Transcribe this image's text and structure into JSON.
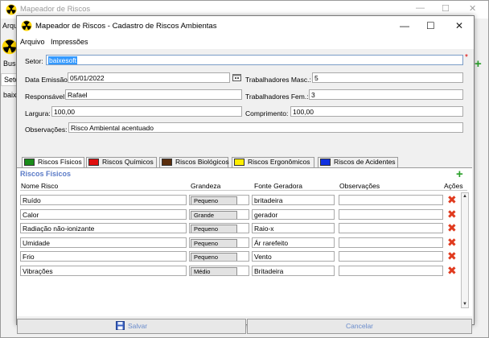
{
  "background_window": {
    "title": "Mapeador de Riscos",
    "menu_partial": "Arqu",
    "search_partial": "Busc",
    "column_partial": "Seto",
    "row_partial": "baix",
    "add_label": "+"
  },
  "dialog": {
    "title": "Mapeador de Riscos - Cadastro de Riscos Ambientas",
    "controls": {
      "minimize": "—",
      "maximize": "☐",
      "close": "✕"
    },
    "menu": [
      "Arquivo",
      "Impressões"
    ]
  },
  "form": {
    "setor_label": "Setor:",
    "setor_value": "baixesoft",
    "required_mark": "*",
    "emissao_label": "Data Emissão:",
    "emissao_value": "05/01/2022",
    "trab_masc_label": "Trabalhadores Masc.:",
    "trab_masc_value": "5",
    "responsavel_label": "Responsável:",
    "responsavel_value": "Rafael",
    "trab_fem_label": "Trabalhadores Fem.:",
    "trab_fem_value": "3",
    "largura_label": "Largura:",
    "largura_value": "100,00",
    "comprimento_label": "Comprimento:",
    "comprimento_value": "100,00",
    "observacoes_label": "Observações:",
    "observacoes_value": "Risco Ambiental acentuado"
  },
  "tabs": [
    {
      "label": "Riscos Físicos",
      "color": "#1a8c1a"
    },
    {
      "label": "Riscos Químicos",
      "color": "#e01010"
    },
    {
      "label": "Riscos Biológicos",
      "color": "#5a2d0c"
    },
    {
      "label": "Riscos Ergonômicos",
      "color": "#ffee00"
    },
    {
      "label": "Riscos de Acidentes",
      "color": "#1030e0"
    }
  ],
  "panel": {
    "section_title": "Riscos Físicos",
    "columns": [
      "Nome Risco",
      "Grandeza",
      "Fonte Geradora",
      "Observações",
      "Ações"
    ],
    "rows": [
      {
        "nome": "Ruído",
        "grandeza": "Pequeno",
        "fonte": "britadeira",
        "obs": ""
      },
      {
        "nome": "Calor",
        "grandeza": "Grande",
        "fonte": "gerador",
        "obs": ""
      },
      {
        "nome": "Radiação não-ionizante",
        "grandeza": "Pequeno",
        "fonte": "Raio-x",
        "obs": ""
      },
      {
        "nome": "Umidade",
        "grandeza": "Pequeno",
        "fonte": "Ár rarefeito",
        "obs": ""
      },
      {
        "nome": "Frio",
        "grandeza": "Pequeno",
        "fonte": "Vento",
        "obs": ""
      },
      {
        "nome": "Vibrações",
        "grandeza": "Médio",
        "fonte": "Britadeira",
        "obs": ""
      }
    ]
  },
  "buttons": {
    "save": "Salvar",
    "cancel": "Cancelar"
  }
}
